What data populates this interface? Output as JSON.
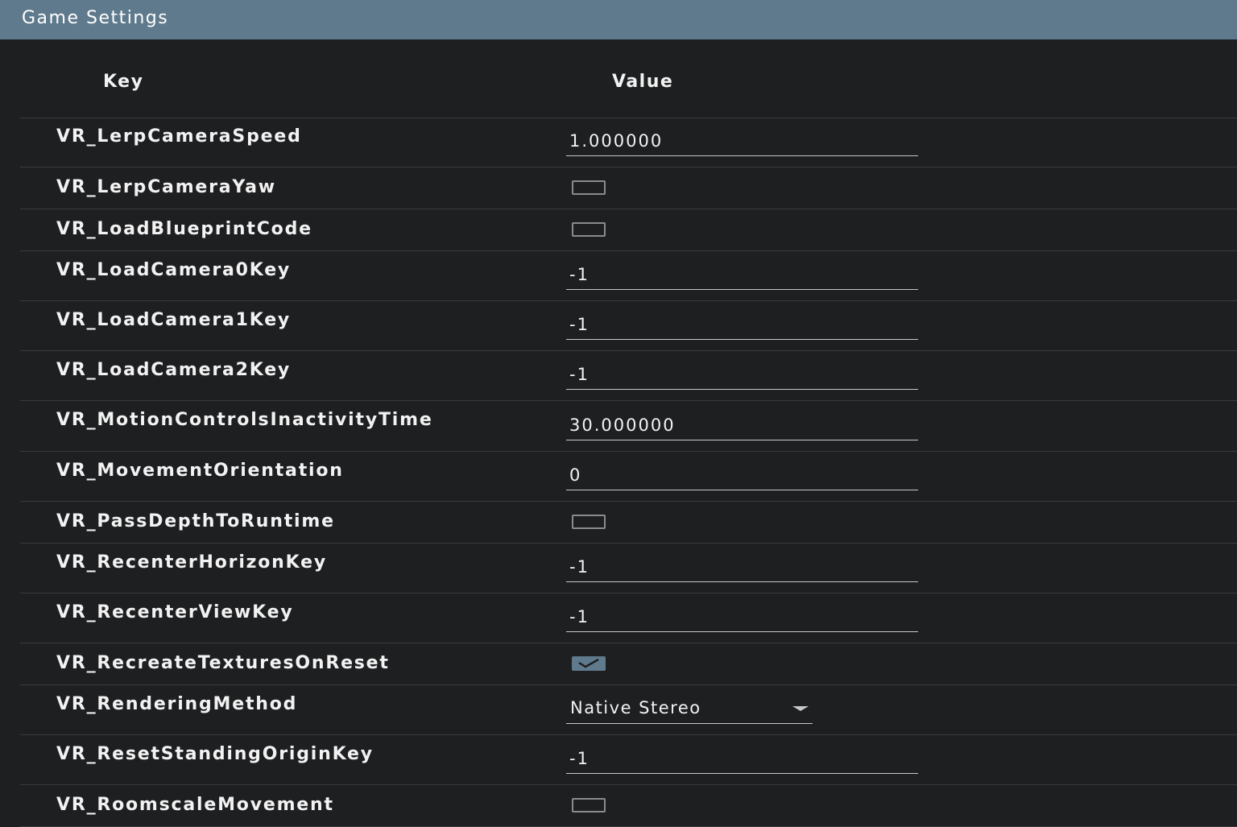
{
  "window": {
    "title": "Game Settings"
  },
  "table": {
    "key_header": "Key",
    "value_header": "Value"
  },
  "rows": [
    {
      "key": "VR_LerpCameraSpeed",
      "type": "text",
      "value": "1.000000"
    },
    {
      "key": "VR_LerpCameraYaw",
      "type": "checkbox",
      "checked": false
    },
    {
      "key": "VR_LoadBlueprintCode",
      "type": "checkbox",
      "checked": false
    },
    {
      "key": "VR_LoadCamera0Key",
      "type": "text",
      "value": "-1"
    },
    {
      "key": "VR_LoadCamera1Key",
      "type": "text",
      "value": "-1"
    },
    {
      "key": "VR_LoadCamera2Key",
      "type": "text",
      "value": "-1"
    },
    {
      "key": "VR_MotionControlsInactivityTime",
      "type": "text",
      "value": "30.000000"
    },
    {
      "key": "VR_MovementOrientation",
      "type": "text",
      "value": "0"
    },
    {
      "key": "VR_PassDepthToRuntime",
      "type": "checkbox",
      "checked": false
    },
    {
      "key": "VR_RecenterHorizonKey",
      "type": "text",
      "value": "-1"
    },
    {
      "key": "VR_RecenterViewKey",
      "type": "text",
      "value": "-1"
    },
    {
      "key": "VR_RecreateTexturesOnReset",
      "type": "checkbox",
      "checked": true
    },
    {
      "key": "VR_RenderingMethod",
      "type": "select",
      "value": "Native Stereo"
    },
    {
      "key": "VR_ResetStandingOriginKey",
      "type": "text",
      "value": "-1"
    },
    {
      "key": "VR_RoomscaleMovement",
      "type": "checkbox",
      "checked": false
    }
  ],
  "colors": {
    "titlebar": "#5f7a8c",
    "background": "#1e1f21",
    "checked": "#5f7a8c"
  }
}
